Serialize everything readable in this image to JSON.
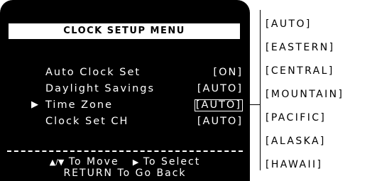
{
  "menu": {
    "title": "CLOCK SETUP MENU",
    "rows": [
      {
        "label": "Auto Clock Set",
        "value": "[ON]"
      },
      {
        "label": "Daylight Savings",
        "value": "[AUTO]"
      },
      {
        "label": "Time Zone",
        "value": "[AUTO]"
      },
      {
        "label": "Clock Set CH",
        "value": "[AUTO]"
      }
    ],
    "pointer_glyph": "▶",
    "hint_line1": {
      "move_glyph": "▲/▼",
      "move_text": "To Move",
      "select_glyph": "▶",
      "select_text": "To Select"
    },
    "hint_line2": "RETURN To Go Back"
  },
  "time_zone_options": [
    "[AUTO]",
    "[EASTERN]",
    "[CENTRAL]",
    "[MOUNTAIN]",
    "[PACIFIC]",
    "[ALASKA]",
    "[HAWAII]"
  ]
}
